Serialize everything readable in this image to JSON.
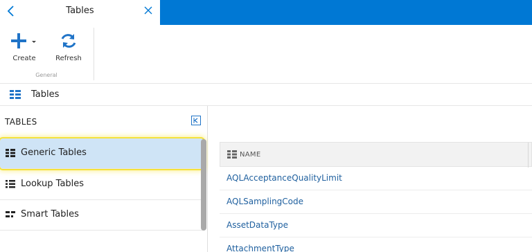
{
  "panel": {
    "title": "Tables"
  },
  "toolbar": {
    "create_label": "Create",
    "refresh_label": "Refresh",
    "group_label": "General"
  },
  "breadcrumb": {
    "label": "Tables"
  },
  "sidebar": {
    "title": "TABLES",
    "items": [
      {
        "label": "Generic Tables",
        "icon": "generic-table-icon",
        "selected": true
      },
      {
        "label": "Lookup Tables",
        "icon": "lookup-table-icon",
        "selected": false
      },
      {
        "label": "Smart Tables",
        "icon": "smart-table-icon",
        "selected": false
      }
    ]
  },
  "grid": {
    "column_header": "NAME",
    "rows": [
      {
        "name": "AQLAcceptanceQualityLimit"
      },
      {
        "name": "AQLSamplingCode"
      },
      {
        "name": "AssetDataType"
      },
      {
        "name": "AttachmentType"
      }
    ]
  },
  "colors": {
    "accent": "#0078d4",
    "selected_bg": "#cfe4f6",
    "highlight": "#f5e23a",
    "link": "#1e5f9e"
  }
}
